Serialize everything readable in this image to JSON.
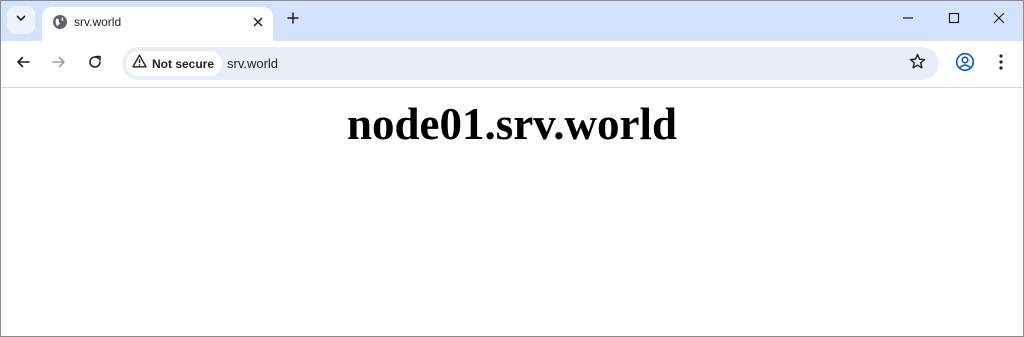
{
  "tab": {
    "title": "srv.world"
  },
  "toolbar": {
    "security_label": "Not secure",
    "url": "srv.world"
  },
  "page": {
    "heading": "node01.srv.world"
  },
  "icons": {
    "tab_search": "chevron-down-icon",
    "favicon": "globe-icon",
    "tab_close": "close-icon",
    "new_tab": "plus-icon",
    "minimize": "minimize-icon",
    "maximize": "maximize-icon",
    "close_window": "close-icon",
    "back": "back-arrow-icon",
    "forward": "forward-arrow-icon",
    "reload": "reload-icon",
    "warning": "warning-icon",
    "bookmark": "star-icon",
    "profile": "profile-icon",
    "menu": "more-vert-icon"
  },
  "colors": {
    "tabstrip_bg": "#d3e3fd",
    "omnibox_bg": "#e9eef6",
    "profile_accent": "#0b57d0"
  }
}
